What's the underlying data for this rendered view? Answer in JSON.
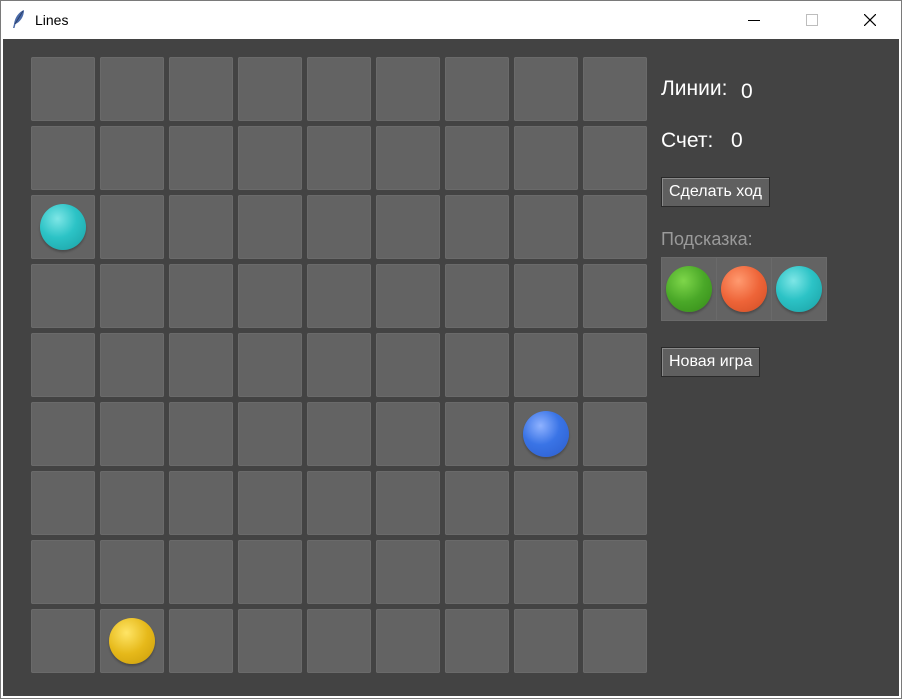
{
  "window": {
    "title": "Lines"
  },
  "colors": {
    "background": "#434343",
    "cell": "#636363",
    "cyan": "#2cc3c6",
    "blue": "#3a74e6",
    "yellow": "#e6b91a",
    "green": "#4aa828",
    "orange": "#ee6438"
  },
  "board": {
    "rows": 9,
    "cols": 9,
    "balls": [
      {
        "row": 2,
        "col": 0,
        "color": "cyan"
      },
      {
        "row": 5,
        "col": 7,
        "color": "blue"
      },
      {
        "row": 8,
        "col": 1,
        "color": "yellow"
      }
    ]
  },
  "side": {
    "lines_label": "Линии:",
    "lines_value": "0",
    "score_label": "Счет:",
    "score_value": "0",
    "move_button": "Сделать ход",
    "hint_label": "Подсказка:",
    "hint_balls": [
      "green",
      "orange",
      "cyan"
    ],
    "new_game_button": "Новая игра"
  }
}
